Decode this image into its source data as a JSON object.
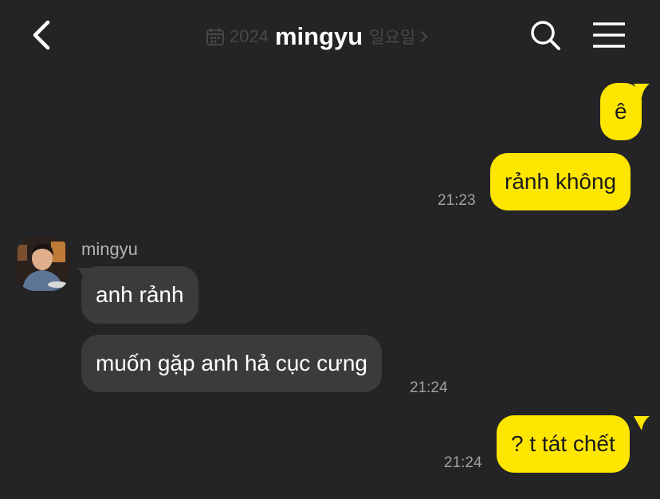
{
  "header": {
    "date": "2024",
    "title": "mingyu",
    "weekday": "일요일"
  },
  "messages": [
    {
      "direction": "outgoing",
      "text": "ê"
    },
    {
      "direction": "outgoing",
      "text": "rảnh không",
      "time": "21:23"
    },
    {
      "direction": "incoming",
      "sender": "mingyu",
      "text": "anh rảnh"
    },
    {
      "direction": "incoming",
      "text": "muốn gặp anh hả cục cưng",
      "time": "21:24"
    },
    {
      "direction": "outgoing",
      "text": "? t tát chết",
      "time": "21:24"
    }
  ],
  "icons": {
    "back": "chevron-left-icon",
    "date": "calendar-icon",
    "search": "search-icon",
    "menu": "hamburger-menu-icon"
  },
  "colors": {
    "background": "#242426",
    "outgoing_bubble": "#ffe600",
    "incoming_bubble": "#3b3b3d",
    "timestamp": "#a1a1a5"
  }
}
